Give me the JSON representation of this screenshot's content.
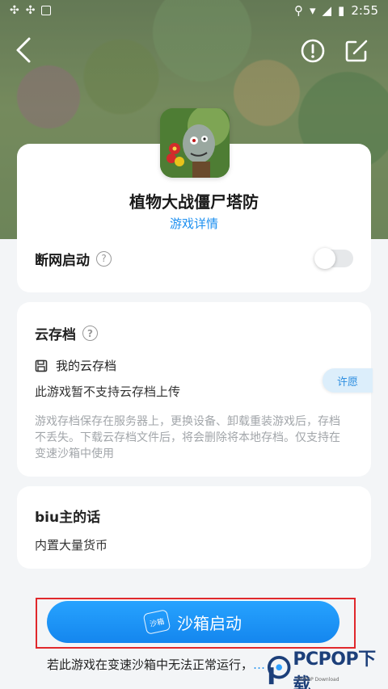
{
  "status_bar": {
    "time": "2:55"
  },
  "app": {
    "title": "植物大战僵尸塔防",
    "details_link": "游戏详情"
  },
  "offline": {
    "label": "断网启动",
    "help": "?"
  },
  "cloud": {
    "title": "云存档",
    "help": "?",
    "my_cloud": "我的云存档",
    "no_support": "此游戏暂不支持云存档上传",
    "description": "游戏存档保存在服务器上，更换设备、卸载重装游戏后，存档不丢失。下载云存档文件后，将会删除将本地存档。仅支持在变速沙箱中使用",
    "wish_button": "许愿"
  },
  "owner": {
    "title": "biu主的话",
    "text": "内置大量货币"
  },
  "launch": {
    "label": "沙箱启动",
    "icon_text": "沙箱"
  },
  "footer": {
    "note": "若此游戏在变速沙箱中无法正常运行，",
    "link": "…"
  },
  "watermark": {
    "text": "PCPOP下载",
    "sub": "PCPOP Download"
  },
  "colors": {
    "accent": "#1e90f0",
    "highlight_frame": "#e0282c"
  }
}
